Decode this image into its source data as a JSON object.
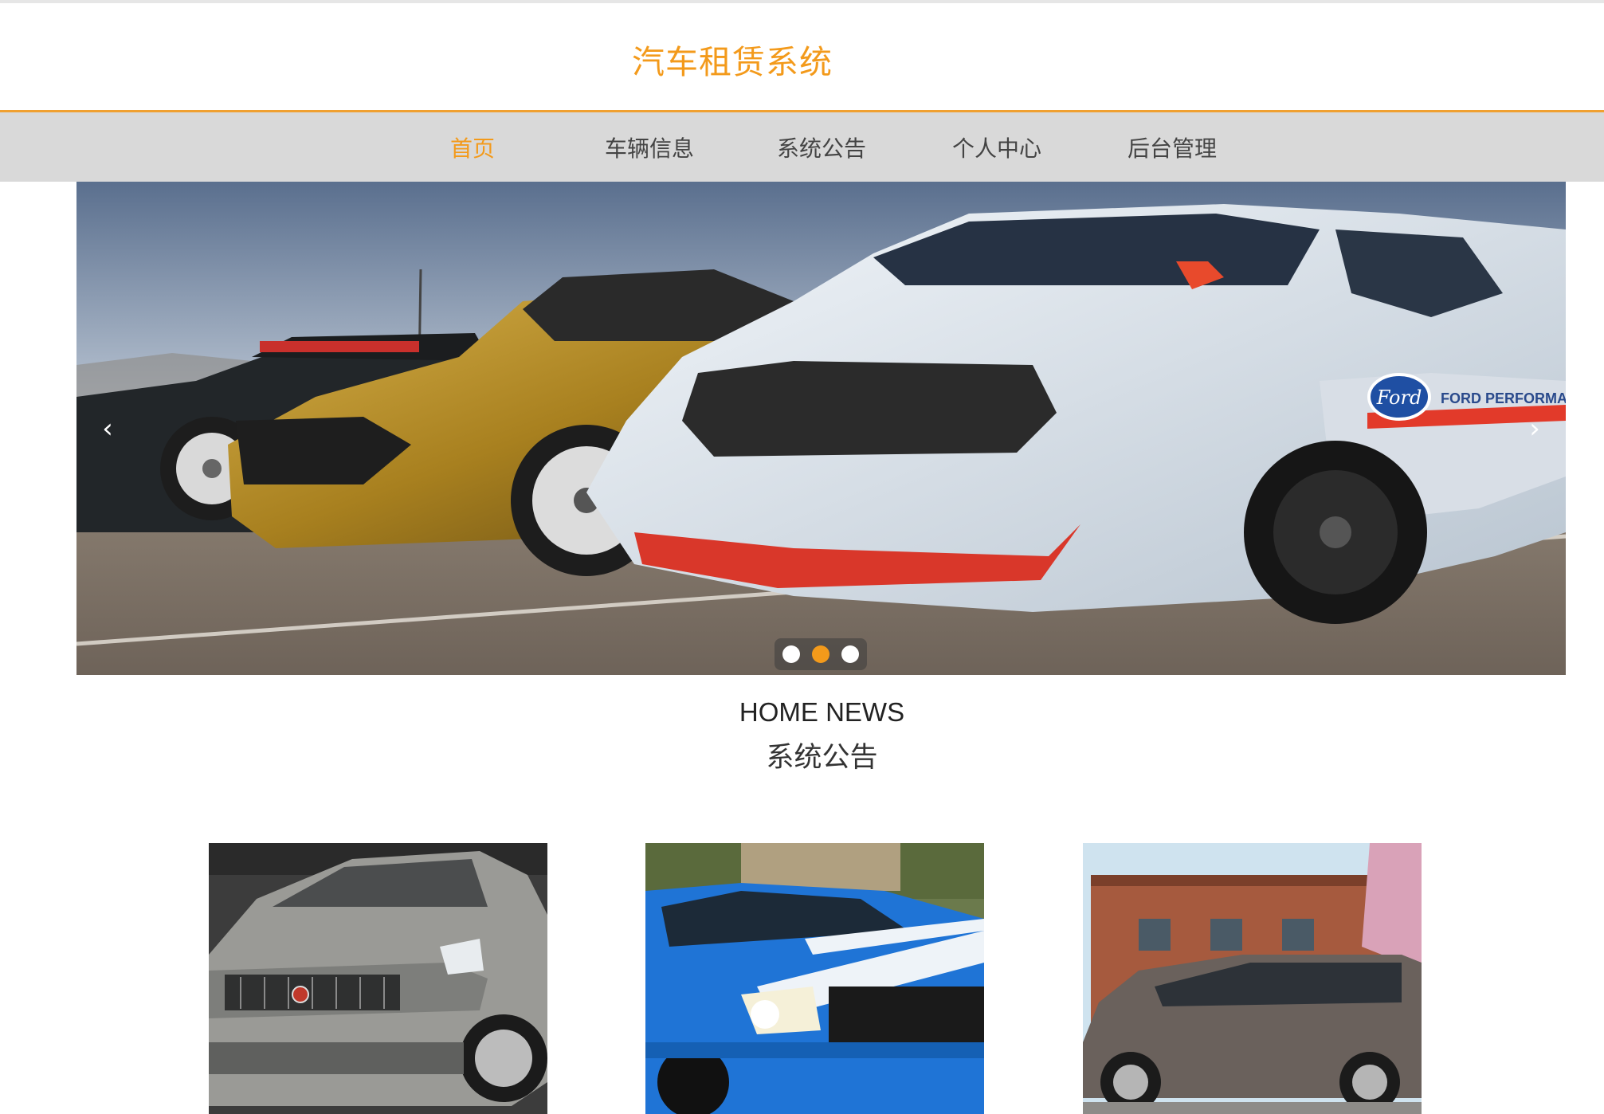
{
  "header": {
    "title": "汽车租赁系统"
  },
  "nav": {
    "items": [
      {
        "label": "首页",
        "active": true
      },
      {
        "label": "车辆信息",
        "active": false
      },
      {
        "label": "系统公告",
        "active": false
      },
      {
        "label": "个人中心",
        "active": false
      },
      {
        "label": "后台管理",
        "active": false
      }
    ]
  },
  "carousel": {
    "prev_icon": "‹",
    "next_icon": "›",
    "slide_count": 3,
    "active_slide": 2,
    "slide_image": "race-cars-photo",
    "logo_text": "Ford",
    "brand_text": "FORD PERFORMANCE"
  },
  "news_section": {
    "title_en": "HOME NEWS",
    "title_cn": "系统公告"
  },
  "cards": [
    {
      "image": "silver-sedan-photo"
    },
    {
      "image": "blue-muscle-car-photo"
    },
    {
      "image": "grey-minivan-photo"
    }
  ],
  "colors": {
    "accent": "#f39a1b",
    "nav_bg": "#d9d9d9"
  }
}
